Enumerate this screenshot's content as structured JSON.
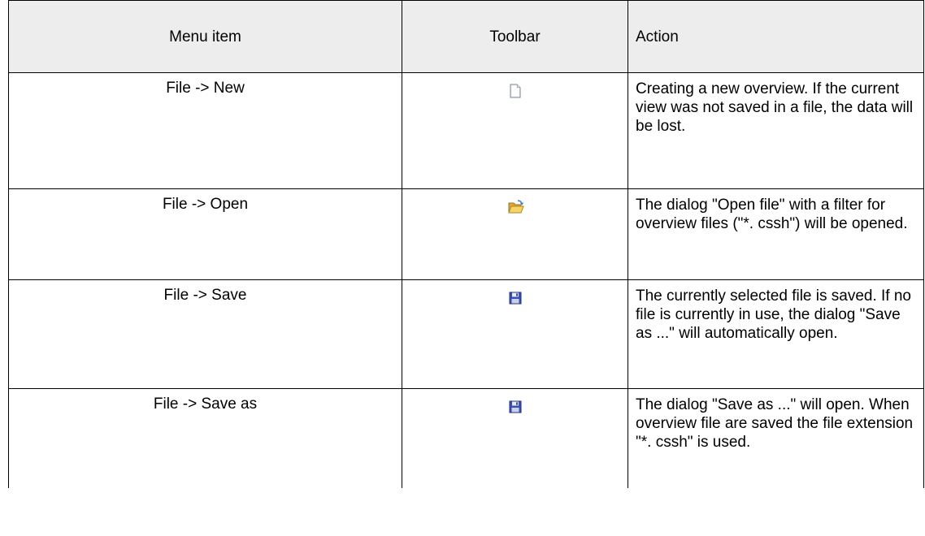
{
  "table": {
    "headers": {
      "menu_item": "Menu item",
      "toolbar": "Toolbar",
      "action": "Action"
    },
    "rows": [
      {
        "menu_item": "File -> New",
        "toolbar_icon": "new-file-icon",
        "action": "Creating a new overview. If the current view was not saved in a file, the data will be lost."
      },
      {
        "menu_item": "File -> Open",
        "toolbar_icon": "open-folder-icon",
        "action": "The dialog \"Open file\" with a filter for overview files (\"*. cssh\") will be opened."
      },
      {
        "menu_item": "File -> Save",
        "toolbar_icon": "save-disk-icon",
        "action": "The currently selected file is saved. If no file is currently in use, the dialog \"Save as ...\" will automatically open."
      },
      {
        "menu_item": "File -> Save as",
        "toolbar_icon": "save-disk-icon",
        "action": "The dialog \"Save as ...\" will open. When overview file are saved the file extension \"*. cssh\" is used."
      }
    ]
  },
  "colors": {
    "header_background": "#ededed",
    "border": "#000000",
    "disk_blue": "#3a4fb0"
  }
}
